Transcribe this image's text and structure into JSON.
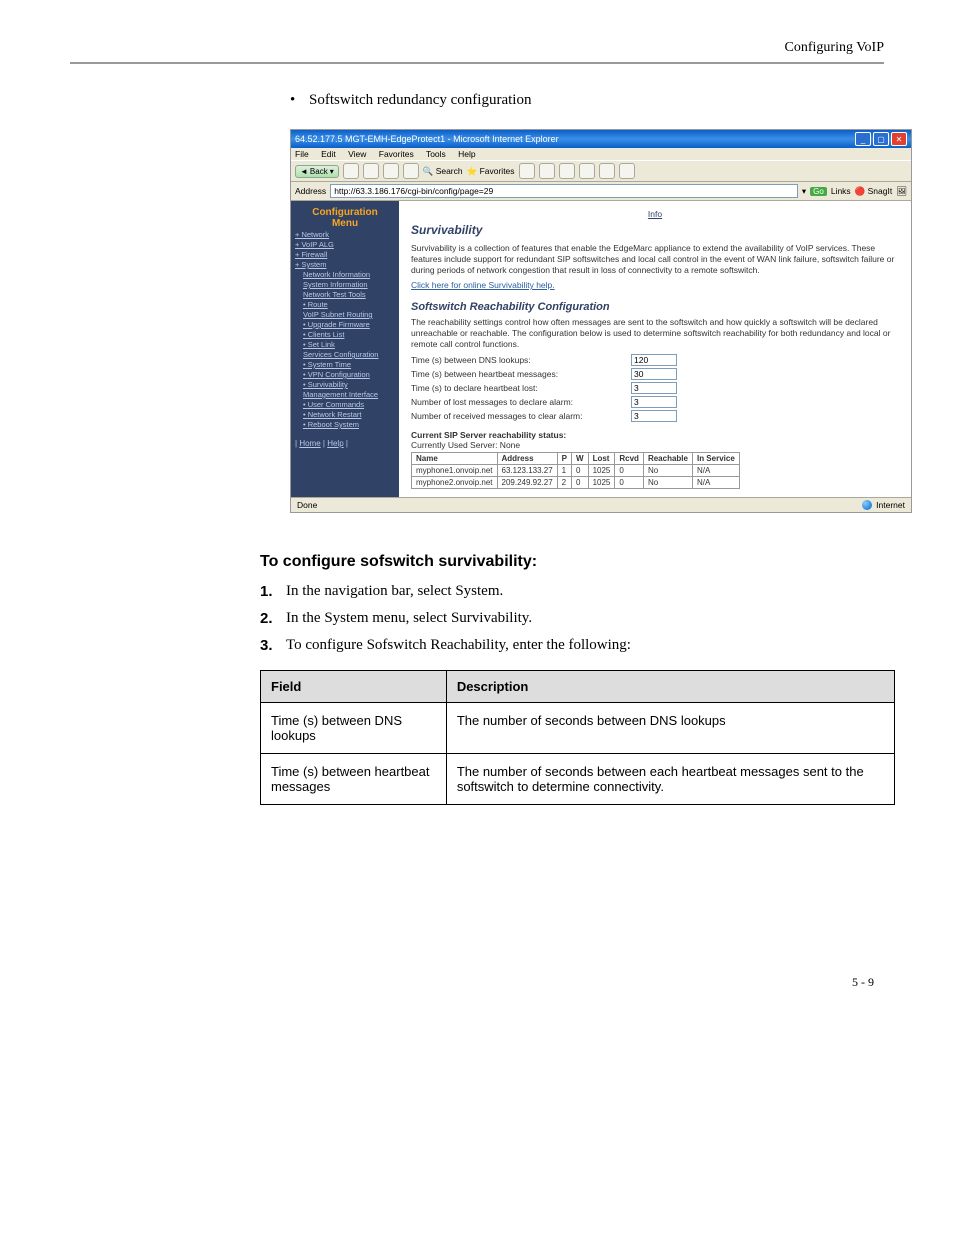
{
  "header": {
    "title": "Configuring VoIP"
  },
  "bullet": "Softswitch redundancy configuration",
  "browser": {
    "titlebar": "64.52.177.5 MGT-EMH-EdgeProtect1 - Microsoft Internet Explorer",
    "menu": {
      "file": "File",
      "edit": "Edit",
      "view": "View",
      "favorites": "Favorites",
      "tools": "Tools",
      "help": "Help"
    },
    "toolbar": {
      "back": "Back",
      "search": "Search",
      "favorites": "Favorites"
    },
    "address_label": "Address",
    "address_value": "http://63.3.186.176/cgi-bin/config/page=29",
    "go": "Go",
    "links": "Links",
    "snagit": "SnagIt",
    "statusbar_left": "Done",
    "statusbar_right": "Internet"
  },
  "sidebar": {
    "title1": "Configuration",
    "title2": "Menu",
    "items": {
      "network": "Network",
      "voipalg": "VoIP ALG",
      "firewall": "Firewall",
      "system": "System",
      "netinfo": "Network Information",
      "sysinfo": "System Information",
      "nettest": "Network Test Tools",
      "route": "Route",
      "voipsubnet": "VoIP Subnet Routing",
      "upgrade": "Upgrade Firmware",
      "clients": "Clients List",
      "setlink": "Set Link",
      "servcfg": "Services Configuration",
      "systime": "System Time",
      "vpncfg": "VPN Configuration",
      "surviv": "Survivability",
      "mgmtif": "Management Interface",
      "usercmd": "User Commands",
      "netrestart": "Network Restart",
      "reboot": "Reboot System"
    },
    "home": "Home",
    "help": "Help"
  },
  "content": {
    "info": "Info",
    "h_surv": "Survivability",
    "p_surv": "Survivability is a collection of features that enable the EdgeMarc appliance to extend the availability of VoIP services. These features include support for redundant SIP softswitches and local call control in the event of WAN link failure, softswitch failure or during periods of network congestion that result in loss of connectivity to a remote softswitch.",
    "help_link": "Click here for online Survivability help.",
    "h_reach": "Softswitch Reachability Configuration",
    "p_reach": "The reachability settings control how often messages are sent to the softswitch and how quickly a softswitch will be declared unreachable or reachable. The configuration below is used to determine softswitch reachability for both redundancy and local or remote call control functions.",
    "form": {
      "dns_label": "Time (s) between DNS lookups:",
      "dns_val": "120",
      "hb_label": "Time (s) between heartbeat messages:",
      "hb_val": "30",
      "lost_label": "Time (s) to declare heartbeat lost:",
      "lost_val": "3",
      "nlost_label": "Number of lost messages to declare alarm:",
      "nlost_val": "3",
      "nrecv_label": "Number of received messages to clear alarm:",
      "nrecv_val": "3"
    },
    "status_title": "Current SIP Server reachability status:",
    "status_sub": "Currently Used Server: None",
    "table": {
      "h_name": "Name",
      "h_addr": "Address",
      "h_p": "P",
      "h_w": "W",
      "h_lost": "Lost",
      "h_rcvd": "Rcvd",
      "h_reach": "Reachable",
      "h_srv": "In Service",
      "r1": {
        "name": "myphone1.onvoip.net",
        "addr": "63.123.133.27",
        "p": "1",
        "w": "0",
        "lost": "1025",
        "rcvd": "0",
        "reach": "No",
        "srv": "N/A"
      },
      "r2": {
        "name": "myphone2.onvoip.net",
        "addr": "209.249.92.27",
        "p": "2",
        "w": "0",
        "lost": "1025",
        "rcvd": "0",
        "reach": "No",
        "srv": "N/A"
      }
    }
  },
  "doc": {
    "section_title": "To configure sofswitch survivability:",
    "steps": {
      "s1n": "1.",
      "s1": "In the navigation bar, select System.",
      "s2n": "2.",
      "s2": "In the System menu, select Survivability.",
      "s3n": "3.",
      "s3": "To configure Sofswitch Reachability, enter the following:"
    },
    "table": {
      "h_field": "Field",
      "h_desc": "Description",
      "r1f": "Time (s) between DNS lookups",
      "r1d": "The number of seconds between DNS lookups",
      "r2f": "Time (s) between heartbeat messages",
      "r2d": "The number of seconds between each heartbeat messages sent to the softswitch to determine connectivity."
    }
  },
  "footer": "5 - 9"
}
